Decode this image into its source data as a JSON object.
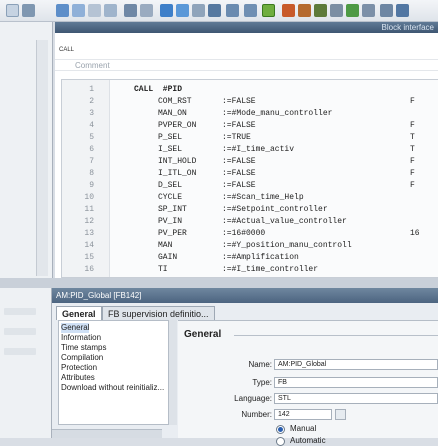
{
  "toolbar": {
    "block_interface": "Block interface"
  },
  "editor": {
    "call_small": "CALL",
    "comment_label": "Comment"
  },
  "code": [
    {
      "n": "1",
      "call": "CALL  #PID"
    },
    {
      "n": "2",
      "param": "COM_RST",
      "val": ":=FALSE",
      "blue": true,
      "right": "F"
    },
    {
      "n": "3",
      "param": "MAN_ON",
      "val": ":=#Mode_manu_controller",
      "right": ""
    },
    {
      "n": "4",
      "param": "PVPER_ON",
      "val": ":=FALSE",
      "blue": true,
      "right": "F"
    },
    {
      "n": "5",
      "param": "P_SEL",
      "val": ":=TRUE",
      "blue": true,
      "right": "T"
    },
    {
      "n": "6",
      "param": "I_SEL",
      "val": ":=#I_time_activ",
      "right": "T"
    },
    {
      "n": "7",
      "param": "INT_HOLD",
      "val": ":=FALSE",
      "blue": true,
      "right": "F"
    },
    {
      "n": "8",
      "param": "I_ITL_ON",
      "val": ":=FALSE",
      "blue": true,
      "right": "F"
    },
    {
      "n": "9",
      "param": "D_SEL",
      "val": ":=FALSE",
      "blue": true,
      "right": "F"
    },
    {
      "n": "10",
      "param": "CYCLE",
      "val": ":=#Scan_time_Help",
      "right": ""
    },
    {
      "n": "11",
      "param": "SP_INT",
      "val": ":=#Setpoint_controller",
      "right": ""
    },
    {
      "n": "12",
      "param": "PV_IN",
      "val": ":=#Actual_value_controller",
      "right": ""
    },
    {
      "n": "13",
      "param": "PV_PER",
      "val": ":=16#0000",
      "blue": true,
      "right": "16"
    },
    {
      "n": "14",
      "param": "MAN",
      "val": ":=#Y_position_manu_controll",
      "right": ""
    },
    {
      "n": "15",
      "param": "GAIN",
      "val": ":=#Amplification",
      "right": ""
    },
    {
      "n": "16",
      "param": "TI",
      "val": ":=#I_time_controller",
      "right": ""
    }
  ],
  "inspector": {
    "title": "AM:PID_Global [FB142]",
    "tabs": [
      "General",
      "FB supervision definitio..."
    ],
    "nav": [
      "General",
      "Information",
      "Time stamps",
      "Compilation",
      "Protection",
      "Attributes",
      "Download without reinitializ..."
    ],
    "section": "General",
    "fields": {
      "name_label": "Name:",
      "name_value": "AM:PID_Global",
      "type_label": "Type:",
      "type_value": "FB",
      "language_label": "Language:",
      "language_value": "STL",
      "number_label": "Number:",
      "number_value": "142",
      "radio_manual": "Manual",
      "radio_automatic": "Automatic"
    }
  },
  "colors": {
    "title_bar": "#4c6480",
    "keyword_blue": "#1b48d6"
  }
}
